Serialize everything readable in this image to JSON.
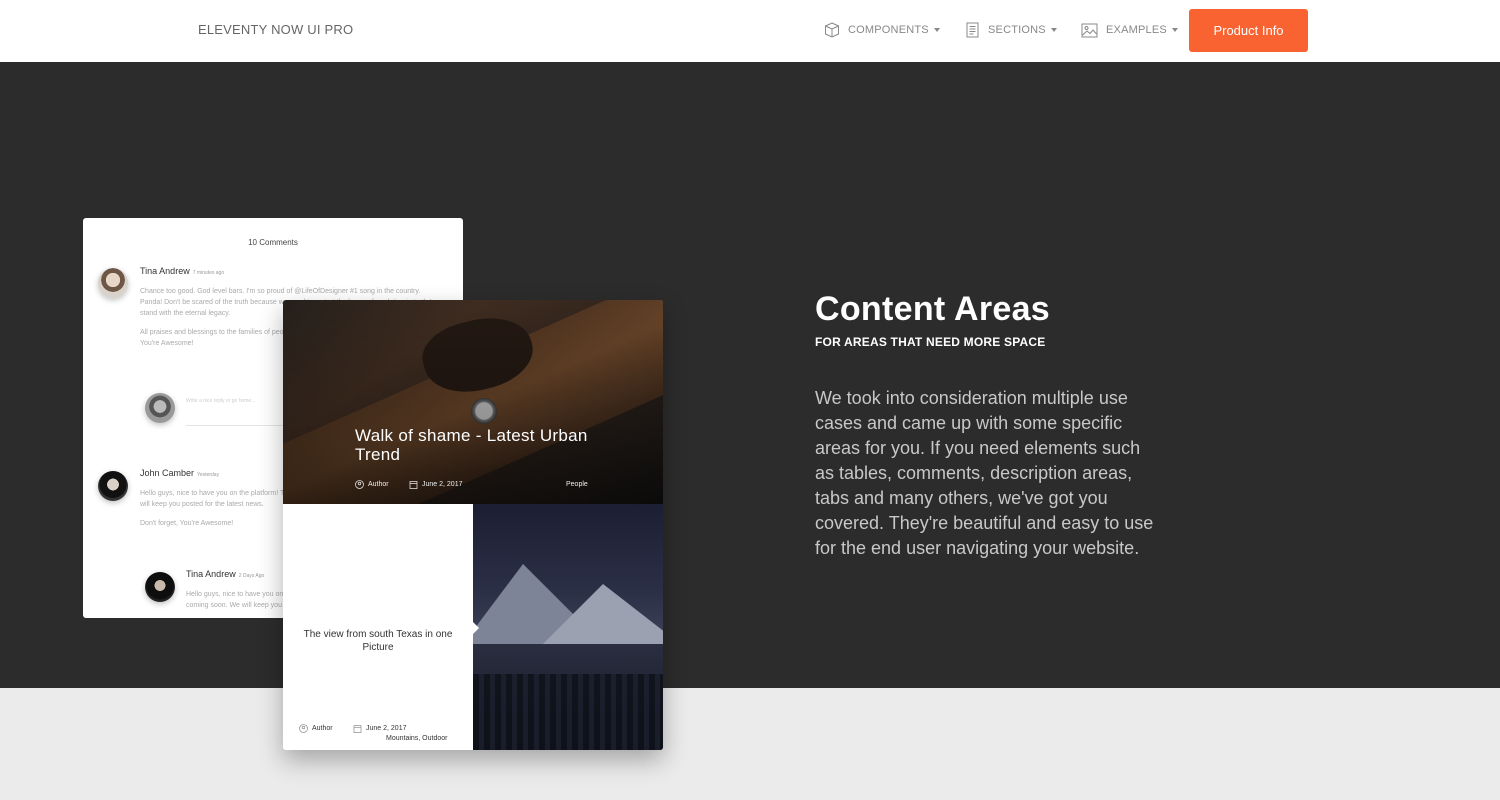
{
  "navbar": {
    "brand": "ELEVENTY NOW UI PRO",
    "items": [
      {
        "label": "COMPONENTS",
        "icon": "box-icon"
      },
      {
        "label": "SECTIONS",
        "icon": "document-icon"
      },
      {
        "label": "EXAMPLES",
        "icon": "image-icon"
      }
    ],
    "cta_label": "Product Info",
    "cta_color": "#f96332"
  },
  "comments_card": {
    "count_label": "10 Comments",
    "comments": [
      {
        "name": "Tina Andrew",
        "time": "7 minutes ago",
        "text1": "Chance too good. God level bars. I'm so proud of @LifeOfDesigner #1 song in the country. Panda! Don't be scared of the truth because we need to restart the human foundation in truth I stand with the eternal legacy.",
        "text2": "All praises and blessings to the families of people who never gave up on dreams. Don't forget, You're Awesome!"
      },
      {
        "name": "John Camber",
        "time": "Yesterday",
        "text1": "Hello guys, nice to have you on the platform! There will be a lot of great stuff coming soon. We will keep you posted for the latest news.",
        "text2": "Don't forget, You're Awesome!"
      },
      {
        "name": "Tina Andrew",
        "time": "2 Days Ago",
        "text1": "Hello guys, nice to have you on the platform! There will be a lot of great stuff coming soon. We will keep you posted for the latest news."
      }
    ],
    "reply_placeholder": "Write a nice reply or go home..."
  },
  "blog_card": {
    "featured": {
      "title": "Walk of shame - Latest Urban Trend",
      "author": "Author",
      "date": "June 2, 2017",
      "category": "People"
    },
    "second": {
      "title": "The view from south Texas in one Picture",
      "author": "Author",
      "date": "June 2, 2017",
      "tags": "Mountains, Outdoor"
    }
  },
  "content": {
    "title": "Content Areas",
    "subtitle": "FOR AREAS THAT NEED MORE SPACE",
    "description": "We took into consideration multiple use cases and came up with some specific areas for you. If you need elements such as tables, comments, description areas, tabs and many others, we've got you covered. They're beautiful and easy to use for the end user navigating your website."
  }
}
